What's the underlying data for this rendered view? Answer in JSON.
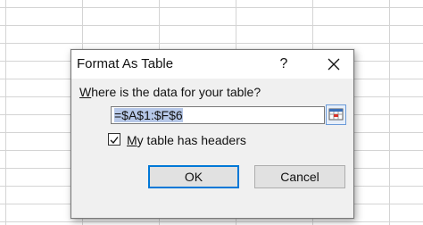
{
  "dialog": {
    "title": "Format As Table",
    "help_label": "?",
    "prompt_accel": "W",
    "prompt_rest": "here is the data for your table?",
    "range_value": "=$A$1:$F$6",
    "headers_checked": true,
    "headers_accel": "M",
    "headers_rest": "y table has headers",
    "ok_label": "OK",
    "cancel_label": "Cancel"
  },
  "icons": {
    "close": "close-icon",
    "collapse": "range-collapse-icon",
    "check": "checkmark-icon"
  },
  "colors": {
    "accent": "#0078d7",
    "dialog_bg": "#f0f0f0",
    "selection": "#b7c8e8"
  }
}
